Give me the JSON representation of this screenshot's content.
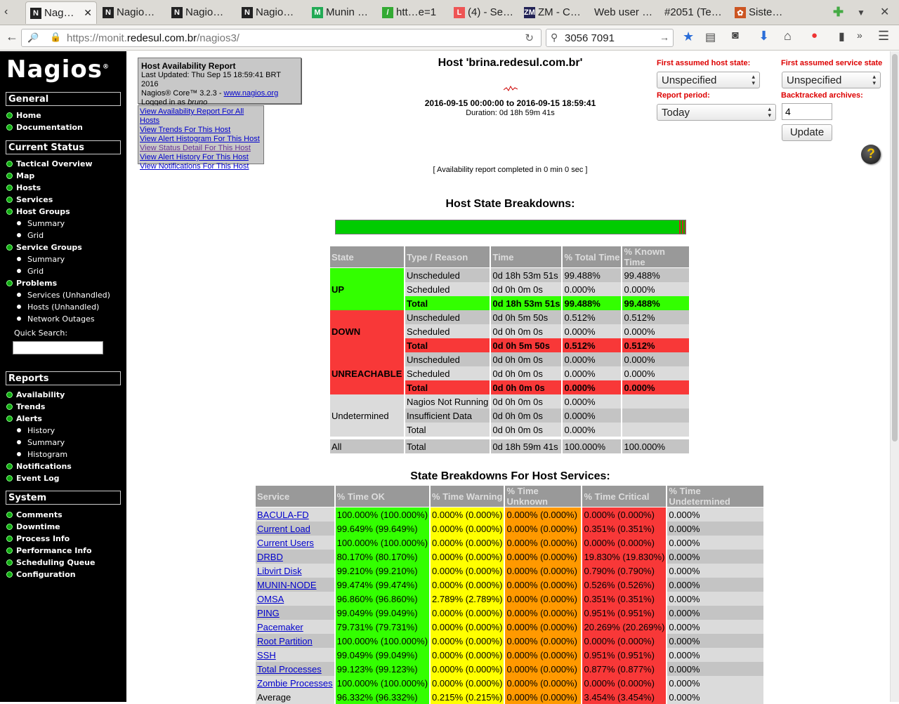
{
  "browser": {
    "tabs": [
      {
        "label": "Nag…",
        "icon": "N",
        "active": true
      },
      {
        "label": "Nagio…",
        "icon": "N"
      },
      {
        "label": "Nagio…",
        "icon": "N"
      },
      {
        "label": "Nagio…",
        "icon": "N"
      },
      {
        "label": "Munin …",
        "icon": "M"
      },
      {
        "label": "htt…e=1",
        "icon": "/"
      },
      {
        "label": "(4) - Se…",
        "icon": "L"
      },
      {
        "label": "ZM - C…",
        "icon": "ZM"
      },
      {
        "label": "Web user …",
        "icon": ""
      },
      {
        "label": "#2051 (Te…",
        "icon": ""
      },
      {
        "label": "Siste…",
        "icon": "✿"
      }
    ],
    "url_prefix": "https://monit.",
    "url_domain": "redesul.com.br",
    "url_path": "/nagios3/",
    "search_value": "3056 7091"
  },
  "sidebar": {
    "logo": "Nagios",
    "logo_mark": "®",
    "sections": {
      "general": "General",
      "current_status": "Current Status",
      "reports": "Reports",
      "system": "System"
    },
    "general_items": [
      "Home",
      "Documentation"
    ],
    "current_items": [
      "Tactical Overview",
      "Map",
      "Hosts",
      "Services",
      "Host Groups"
    ],
    "host_group_subs": [
      "Summary",
      "Grid"
    ],
    "service_groups": "Service Groups",
    "service_group_subs": [
      "Summary",
      "Grid"
    ],
    "problems": "Problems",
    "problem_subs": [
      "Services (Unhandled)",
      "Hosts (Unhandled)",
      "Network Outages"
    ],
    "quick_search": "Quick Search:",
    "report_items": [
      "Availability",
      "Trends",
      "Alerts"
    ],
    "alert_subs": [
      "History",
      "Summary",
      "Histogram"
    ],
    "report_items2": [
      "Notifications",
      "Event Log"
    ],
    "system_items": [
      "Comments",
      "Downtime",
      "Process Info",
      "Performance Info",
      "Scheduling Queue",
      "Configuration"
    ]
  },
  "info": {
    "title": "Host Availability Report",
    "updated": "Last Updated: Thu Sep 15 18:59:41 BRT 2016",
    "core": "Nagios® Core™ 3.2.3 - ",
    "core_link": "www.nagios.org",
    "logged": "Logged in as ",
    "user": "bruno"
  },
  "links": [
    "View Availability Report For All Hosts",
    "View Trends For This Host",
    "View Alert Histogram For This Host",
    "View Status Detail For This Host",
    "View Alert History For This Host",
    "View Notifications For This Host"
  ],
  "report": {
    "host_title": "Host 'brina.redesul.com.br'",
    "range": "2016-09-15 00:00:00 to 2016-09-15 18:59:41",
    "duration": "Duration: 0d 18h 59m 41s",
    "completed": "[ Availability report completed in 0 min 0 sec ]",
    "state_breakdowns_title": "Host State Breakdowns:",
    "services_title": "State Breakdowns For Host Services:",
    "bar_up_percent": 99.488,
    "bar_down_percent": 0.512
  },
  "form": {
    "host_state_label": "First assumed host state:",
    "host_state_value": "Unspecified",
    "service_state_label": "First assumed service state",
    "service_state_value": "Unspecified",
    "period_label": "Report period:",
    "period_value": "Today",
    "backtrack_label": "Backtracked archives:",
    "backtrack_value": "4",
    "update_label": "Update"
  },
  "host_table": {
    "headers": [
      "State",
      "Type / Reason",
      "Time",
      "% Total Time",
      "% Known Time"
    ],
    "groups": [
      {
        "state": "UP",
        "cls": "up",
        "rows": [
          [
            "Unscheduled",
            "0d 18h 53m 51s",
            "99.488%",
            "99.488%"
          ],
          [
            "Scheduled",
            "0d 0h 0m 0s",
            "0.000%",
            "0.000%"
          ],
          [
            "Total",
            "0d 18h 53m 51s",
            "99.488%",
            "99.488%"
          ]
        ]
      },
      {
        "state": "DOWN",
        "cls": "down",
        "rows": [
          [
            "Unscheduled",
            "0d 0h 5m 50s",
            "0.512%",
            "0.512%"
          ],
          [
            "Scheduled",
            "0d 0h 0m 0s",
            "0.000%",
            "0.000%"
          ],
          [
            "Total",
            "0d 0h 5m 50s",
            "0.512%",
            "0.512%"
          ]
        ]
      },
      {
        "state": "UNREACHABLE",
        "cls": "unr",
        "rows": [
          [
            "Unscheduled",
            "0d 0h 0m 0s",
            "0.000%",
            "0.000%"
          ],
          [
            "Scheduled",
            "0d 0h 0m 0s",
            "0.000%",
            "0.000%"
          ],
          [
            "Total",
            "0d 0h 0m 0s",
            "0.000%",
            "0.000%"
          ]
        ]
      },
      {
        "state": "Undetermined",
        "cls": "undet",
        "rows": [
          [
            "Nagios Not Running",
            "0d 0h 0m 0s",
            "0.000%",
            ""
          ],
          [
            "Insufficient Data",
            "0d 0h 0m 0s",
            "0.000%",
            ""
          ],
          [
            "Total",
            "0d 0h 0m 0s",
            "0.000%",
            ""
          ]
        ]
      }
    ],
    "all_row": [
      "All",
      "Total",
      "0d 18h 59m 41s",
      "100.000%",
      "100.000%"
    ]
  },
  "service_table": {
    "headers": [
      "Service",
      "% Time OK",
      "% Time Warning",
      "% Time Unknown",
      "% Time Critical",
      "% Time Undetermined"
    ],
    "rows": [
      [
        "BACULA-FD",
        "100.000% (100.000%)",
        "0.000% (0.000%)",
        "0.000% (0.000%)",
        "0.000% (0.000%)",
        "0.000%"
      ],
      [
        "Current Load",
        "99.649% (99.649%)",
        "0.000% (0.000%)",
        "0.000% (0.000%)",
        "0.351% (0.351%)",
        "0.000%"
      ],
      [
        "Current Users",
        "100.000% (100.000%)",
        "0.000% (0.000%)",
        "0.000% (0.000%)",
        "0.000% (0.000%)",
        "0.000%"
      ],
      [
        "DRBD",
        "80.170% (80.170%)",
        "0.000% (0.000%)",
        "0.000% (0.000%)",
        "19.830% (19.830%)",
        "0.000%"
      ],
      [
        "Libvirt Disk",
        "99.210% (99.210%)",
        "0.000% (0.000%)",
        "0.000% (0.000%)",
        "0.790% (0.790%)",
        "0.000%"
      ],
      [
        "MUNIN-NODE",
        "99.474% (99.474%)",
        "0.000% (0.000%)",
        "0.000% (0.000%)",
        "0.526% (0.526%)",
        "0.000%"
      ],
      [
        "OMSA",
        "96.860% (96.860%)",
        "2.789% (2.789%)",
        "0.000% (0.000%)",
        "0.351% (0.351%)",
        "0.000%"
      ],
      [
        "PING",
        "99.049% (99.049%)",
        "0.000% (0.000%)",
        "0.000% (0.000%)",
        "0.951% (0.951%)",
        "0.000%"
      ],
      [
        "Pacemaker",
        "79.731% (79.731%)",
        "0.000% (0.000%)",
        "0.000% (0.000%)",
        "20.269% (20.269%)",
        "0.000%"
      ],
      [
        "Root Partition",
        "100.000% (100.000%)",
        "0.000% (0.000%)",
        "0.000% (0.000%)",
        "0.000% (0.000%)",
        "0.000%"
      ],
      [
        "SSH",
        "99.049% (99.049%)",
        "0.000% (0.000%)",
        "0.000% (0.000%)",
        "0.951% (0.951%)",
        "0.000%"
      ],
      [
        "Total Processes",
        "99.123% (99.123%)",
        "0.000% (0.000%)",
        "0.000% (0.000%)",
        "0.877% (0.877%)",
        "0.000%"
      ],
      [
        "Zombie Processes",
        "100.000% (100.000%)",
        "0.000% (0.000%)",
        "0.000% (0.000%)",
        "0.000% (0.000%)",
        "0.000%"
      ]
    ],
    "average": [
      "Average",
      "96.332% (96.332%)",
      "0.215% (0.215%)",
      "0.000% (0.000%)",
      "3.454% (3.454%)",
      "0.000%"
    ]
  },
  "colors": {
    "ok": "#33ff00",
    "warning": "#ffff00",
    "unknown": "#ff9900",
    "critical": "#f83838",
    "header": "#999999"
  }
}
